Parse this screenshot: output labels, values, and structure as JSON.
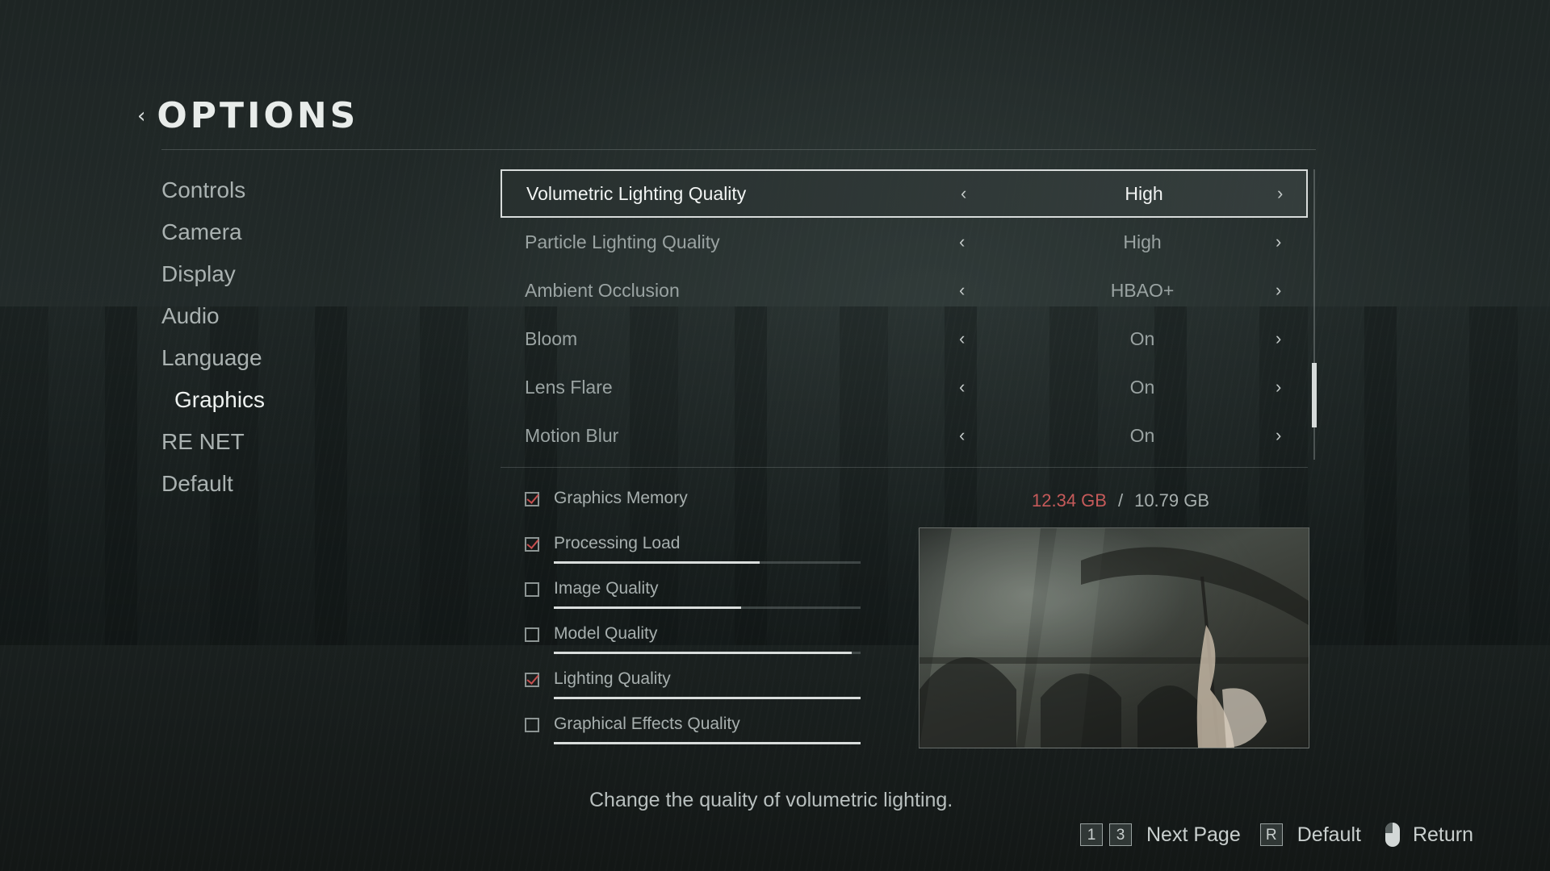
{
  "header": {
    "back_glyph": "‹",
    "title": "OPTIONS"
  },
  "sidebar": {
    "items": [
      {
        "label": "Controls",
        "active": false
      },
      {
        "label": "Camera",
        "active": false
      },
      {
        "label": "Display",
        "active": false
      },
      {
        "label": "Audio",
        "active": false
      },
      {
        "label": "Language",
        "active": false
      },
      {
        "label": "Graphics",
        "active": true
      },
      {
        "label": "RE NET",
        "active": false
      },
      {
        "label": "Default",
        "active": false
      }
    ]
  },
  "settings": {
    "arrow_left": "‹",
    "arrow_right": "›",
    "rows": [
      {
        "label": "Volumetric Lighting Quality",
        "value": "High",
        "selected": true
      },
      {
        "label": "Particle Lighting Quality",
        "value": "High",
        "selected": false
      },
      {
        "label": "Ambient Occlusion",
        "value": "HBAO+",
        "selected": false
      },
      {
        "label": "Bloom",
        "value": "On",
        "selected": false
      },
      {
        "label": "Lens Flare",
        "value": "On",
        "selected": false
      },
      {
        "label": "Motion Blur",
        "value": "On",
        "selected": false
      }
    ]
  },
  "meters": {
    "memory": {
      "label": "Graphics Memory",
      "checked": true,
      "used": "12.34 GB",
      "separator": "/",
      "total": "10.79 GB"
    },
    "items": [
      {
        "label": "Processing Load",
        "checked": true,
        "level": 0.67
      },
      {
        "label": "Image Quality",
        "checked": false,
        "level": 0.61
      },
      {
        "label": "Model Quality",
        "checked": false,
        "level": 0.97
      },
      {
        "label": "Lighting Quality",
        "checked": true,
        "level": 1.0
      },
      {
        "label": "Graphical Effects Quality",
        "checked": false,
        "level": 1.0
      }
    ]
  },
  "description": "Change the quality of volumetric lighting.",
  "footer": {
    "next_page_keys": [
      "1",
      "3"
    ],
    "next_page_label": "Next Page",
    "default_key": "R",
    "default_label": "Default",
    "return_label": "Return"
  },
  "colors": {
    "accent_red": "#c55a5a",
    "selected_border": "#d8dcdb"
  }
}
